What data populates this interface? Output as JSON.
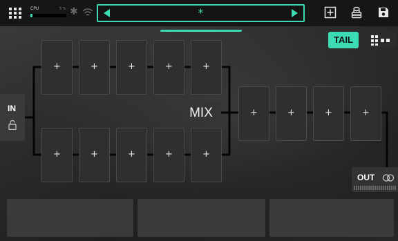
{
  "topbar": {
    "cpu_label": "CPU",
    "cpu_percent_text": "5 %",
    "cpu_load": 0.05,
    "preset_name": "*"
  },
  "routing": {
    "tail_label": "TAIL",
    "in_label": "IN",
    "mix_label": "MIX",
    "out_label": "OUT"
  },
  "slots": {
    "plus": "+"
  },
  "colors": {
    "accent": "#3ddbb3",
    "background": "#2a2a2a",
    "topbar": "#161616",
    "slot": "#2f2f2f",
    "panel": "#3a3a3a"
  },
  "icons": {
    "menu": "grid-icon",
    "bluetooth": "bluetooth-icon",
    "wifi": "wifi-icon",
    "add_preset": "add-box-icon",
    "pedal": "pedal-icon",
    "save": "save-icon",
    "lock": "unlock-icon",
    "out_link": "stereo-link-icon",
    "layout": "layout-grid-icon"
  }
}
